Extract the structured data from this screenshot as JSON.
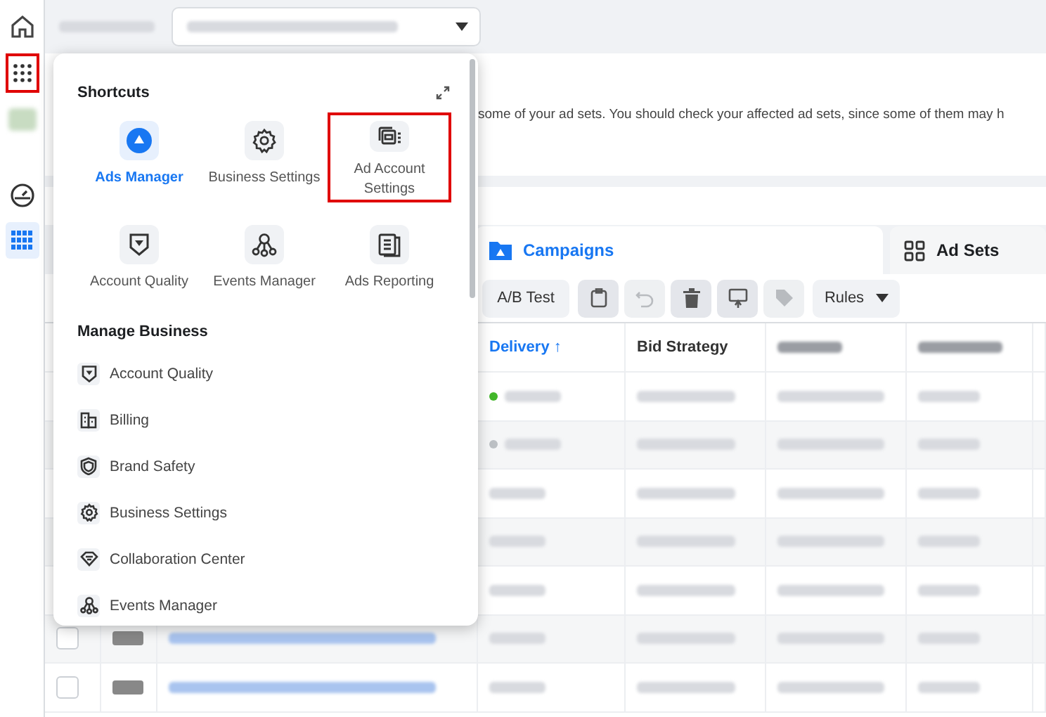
{
  "sidebar": {
    "items": [
      {
        "kind": "home",
        "selected": false,
        "highlighted": false
      },
      {
        "kind": "apps",
        "selected": false,
        "highlighted": true
      },
      {
        "kind": "thumbnail",
        "selected": false,
        "highlighted": false
      },
      {
        "kind": "gauge",
        "selected": false,
        "highlighted": false
      },
      {
        "kind": "table",
        "selected": true,
        "highlighted": false
      }
    ]
  },
  "notice": {
    "text": "some of your ad sets. You should check your affected ad sets, since some of them may h"
  },
  "tabs": [
    {
      "label": "Campaigns",
      "kind": "folder",
      "selected": true
    },
    {
      "label": "Ad Sets",
      "kind": "grid",
      "selected": false
    }
  ],
  "toolbar": {
    "ab_test": "A/B Test",
    "rules": "Rules",
    "icon_buttons": [
      {
        "kind": "clipboard",
        "disabled": false
      },
      {
        "kind": "undo",
        "disabled": true
      },
      {
        "kind": "trash",
        "disabled": false
      },
      {
        "kind": "duplicate",
        "disabled": false
      },
      {
        "kind": "tag",
        "disabled": true
      }
    ]
  },
  "table": {
    "columns": [
      {
        "label": "Delivery ↑",
        "sorted": true
      },
      {
        "label": "Bid Strategy",
        "sorted": false
      }
    ],
    "rows": [
      {
        "color": "#42b72a"
      },
      {
        "color": "#bcc0c4"
      },
      {
        "color": null
      },
      {
        "color": null
      },
      {
        "color": null
      },
      {
        "checked": false,
        "color": null
      },
      {
        "checked": false,
        "color": null
      }
    ]
  },
  "menu": {
    "shortcuts": {
      "title": "Shortcuts",
      "items": [
        {
          "label": "Ads Manager",
          "kind": "ads",
          "selected": true,
          "highlighted": false
        },
        {
          "label": "Business Settings",
          "kind": "gear",
          "selected": false,
          "highlighted": false
        },
        {
          "label": "Ad Account Settings",
          "kind": "account",
          "selected": false,
          "highlighted": true
        },
        {
          "label": "Account Quality",
          "kind": "shield",
          "selected": false,
          "highlighted": false
        },
        {
          "label": "Events Manager",
          "kind": "events",
          "selected": false,
          "highlighted": false
        },
        {
          "label": "Ads Reporting",
          "kind": "report",
          "selected": false,
          "highlighted": false
        }
      ]
    },
    "manage_business": {
      "title": "Manage Business",
      "items": [
        {
          "label": "Account Quality",
          "kind": "shield"
        },
        {
          "label": "Billing",
          "kind": "billing"
        },
        {
          "label": "Brand Safety",
          "kind": "safety"
        },
        {
          "label": "Business Settings",
          "kind": "gear"
        },
        {
          "label": "Collaboration Center",
          "kind": "collab"
        },
        {
          "label": "Events Manager",
          "kind": "events"
        }
      ]
    }
  }
}
